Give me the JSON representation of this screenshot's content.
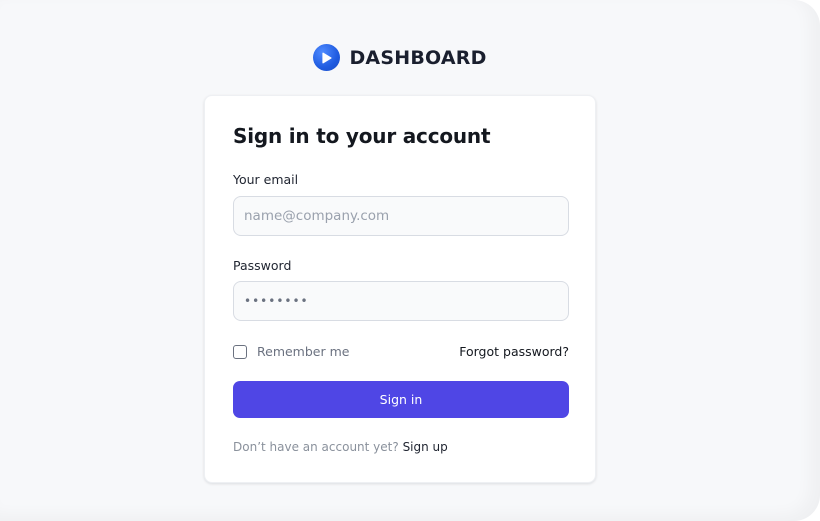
{
  "brand": {
    "name": "DASHBOARD",
    "logo_icon": "play-circle-icon",
    "logo_color": "#1f5be0"
  },
  "form": {
    "title": "Sign in to your account",
    "email_label": "Your email",
    "email_placeholder": "name@company.com",
    "email_value": "",
    "password_label": "Password",
    "password_value": "••••••••",
    "remember_label": "Remember me",
    "remember_checked": false,
    "forgot_label": "Forgot password?",
    "submit_label": "Sign in",
    "signup_prompt": "Don’t have an account yet?",
    "signup_link": "Sign up"
  },
  "colors": {
    "accent": "#4f46e5",
    "background": "#f7f8fa",
    "card": "#ffffff"
  }
}
